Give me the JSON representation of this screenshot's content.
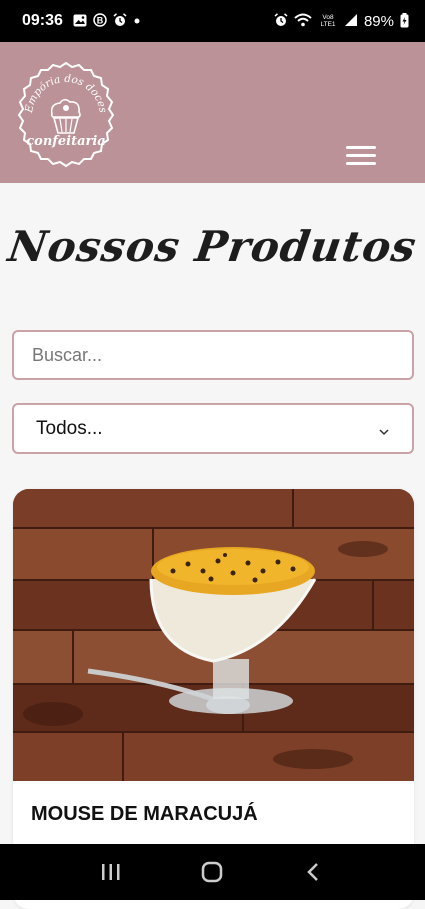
{
  "status_bar": {
    "time": "09:36",
    "battery": "89%",
    "icons_left": [
      "gallery-icon",
      "b-icon",
      "alarm-icon",
      "dot-icon"
    ],
    "icons_right": [
      "alarm-icon",
      "wifi-icon",
      "volte-icon",
      "signal-icon",
      "battery-icon"
    ]
  },
  "header": {
    "logo_text_top": "Empória dos doces",
    "logo_text_bottom": "confeitaria",
    "background": "#bb9297"
  },
  "page": {
    "title": "Nossos Produtos"
  },
  "search": {
    "placeholder": "Buscar..."
  },
  "filter": {
    "selected": "Todos..."
  },
  "products": [
    {
      "name": "MOUSE DE MARACUJÁ",
      "image_icon": "passion-fruit-mousse-photo"
    }
  ],
  "nav": {
    "buttons": [
      "recent-apps-icon",
      "home-icon",
      "back-icon"
    ]
  }
}
